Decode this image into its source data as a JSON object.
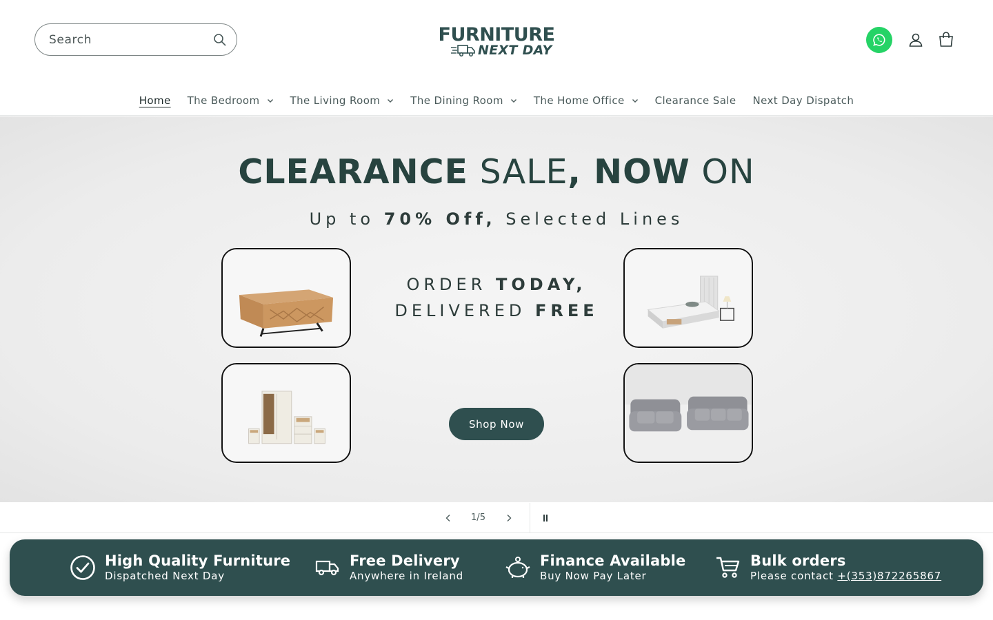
{
  "header": {
    "search_placeholder": "Search",
    "logo_line1": "FURNITURE",
    "logo_line2": "NEXT DAY",
    "icons": [
      "search-icon",
      "whatsapp-icon",
      "account-icon",
      "cart-icon"
    ]
  },
  "nav": {
    "items": [
      {
        "label": "Home",
        "active": true,
        "dropdown": false
      },
      {
        "label": "The Bedroom",
        "dropdown": true
      },
      {
        "label": "The Living Room",
        "dropdown": true
      },
      {
        "label": "The Dining Room",
        "dropdown": true
      },
      {
        "label": "The Home Office",
        "dropdown": true
      },
      {
        "label": "Clearance Sale",
        "dropdown": false
      },
      {
        "label": "Next Day Dispatch",
        "dropdown": false
      }
    ]
  },
  "hero": {
    "title_bold1": "CLEARANCE",
    "title_light1": " SALE",
    "title_bold2": ", NOW",
    "title_light2": " ON",
    "sub_pre": "Up to ",
    "sub_bold": "70% Off,",
    "sub_post": " Selected Lines",
    "order_pre": "ORDER ",
    "order_bold": "TODAY,",
    "delivered_pre": "DELIVERED ",
    "delivered_bold": "FREE",
    "button": "Shop Now"
  },
  "slider": {
    "current": "1",
    "separator": "/",
    "total": "5"
  },
  "features": [
    {
      "icon": "check-circle-icon",
      "title": "High Quality Furniture",
      "sub": "Dispatched Next Day"
    },
    {
      "icon": "truck-icon",
      "title": "Free Delivery",
      "sub": "Anywhere in Ireland"
    },
    {
      "icon": "piggy-bank-icon",
      "title": "Finance Available",
      "sub": "Buy Now Pay Later"
    },
    {
      "icon": "cart-icon",
      "title": "Bulk orders",
      "sub_pre": "Please contact ",
      "sub_link": "+(353)872265867"
    }
  ],
  "colors": {
    "brand": "#2f4f4f",
    "whatsapp": "#25d366"
  }
}
